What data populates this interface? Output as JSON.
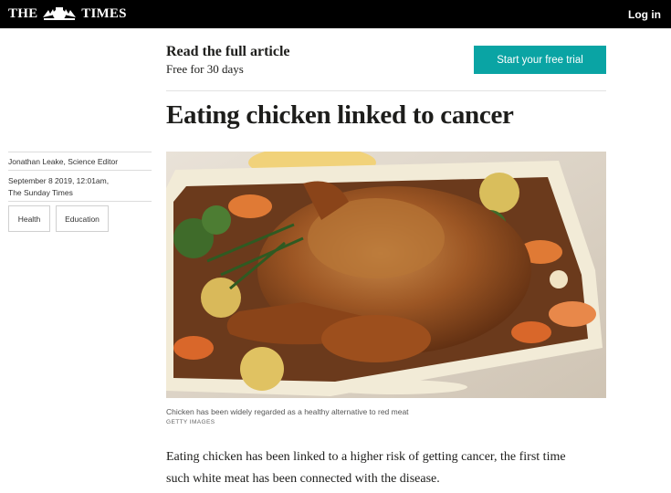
{
  "header": {
    "logo_left": "THE",
    "logo_right": "TIMES",
    "login_label": "Log in",
    "colors": {
      "bar": "#000000",
      "text": "#ffffff"
    }
  },
  "promo": {
    "title": "Read the full article",
    "subtitle": "Free for 30 days",
    "cta_label": "Start your free trial",
    "cta_color": "#0aa4a4"
  },
  "article": {
    "headline": "Eating chicken linked to cancer",
    "author": "Jonathan Leake, Science Editor",
    "date": "September 8 2019, 12:01am,",
    "publication": "The Sunday Times",
    "tags": [
      {
        "label": "Health"
      },
      {
        "label": "Education"
      }
    ],
    "image": {
      "alt_icon": "roast-chicken-photo",
      "caption": "Chicken has been widely regarded as a healthy alternative to red meat",
      "credit": "GETTY IMAGES"
    },
    "body_first_line": "Eating chicken has been linked to a higher risk of getting cancer, the first time",
    "body_second_line": "such white meat has been connected with the disease."
  }
}
